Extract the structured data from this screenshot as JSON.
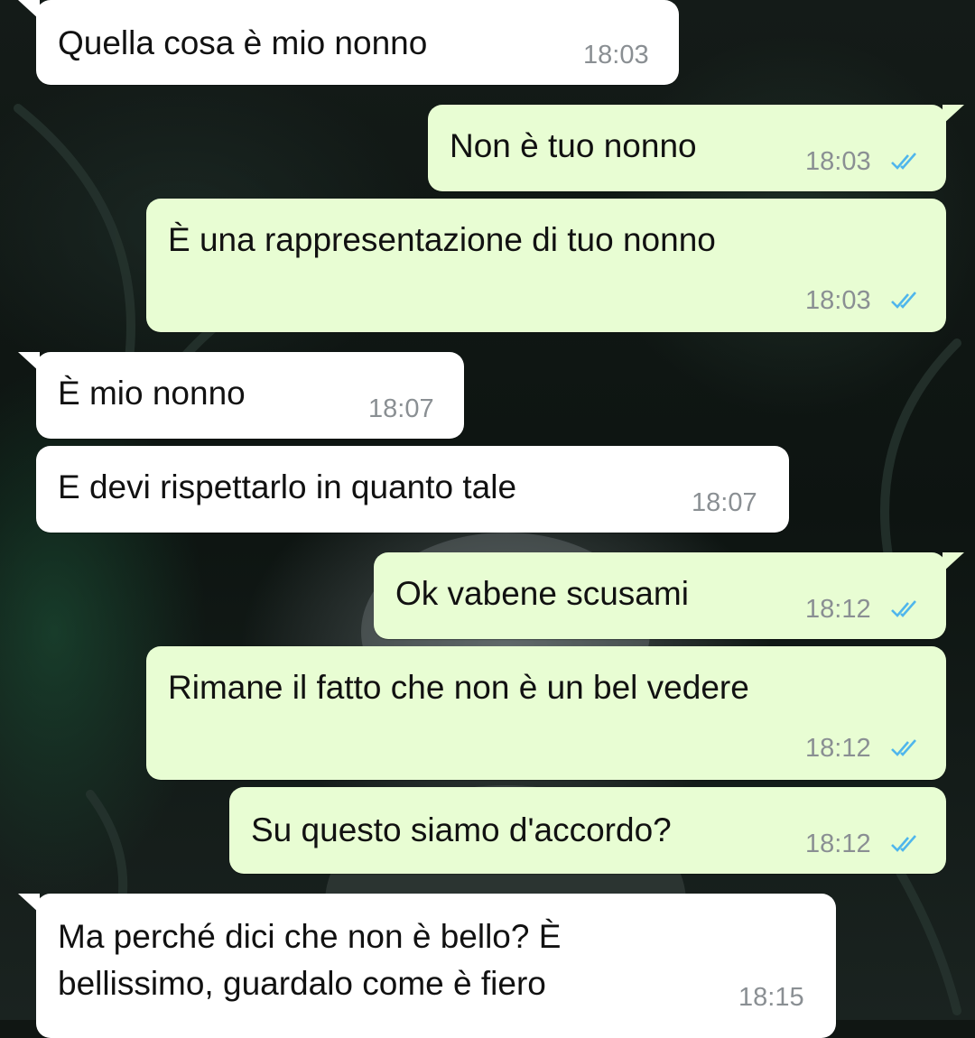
{
  "messages": [
    {
      "side": "in",
      "text": "Quella cosa è mio nonno",
      "time": "18:03"
    },
    {
      "side": "out",
      "text": "Non è tuo nonno",
      "time": "18:03",
      "status": "read"
    },
    {
      "side": "out",
      "text": "È una rappresentazione di tuo nonno",
      "time": "18:03",
      "status": "read"
    },
    {
      "side": "in",
      "text": "È mio nonno",
      "time": "18:07"
    },
    {
      "side": "in",
      "text": "E devi rispettarlo in quanto tale",
      "time": "18:07"
    },
    {
      "side": "out",
      "text": "Ok vabene scusami",
      "time": "18:12",
      "status": "read"
    },
    {
      "side": "out",
      "text": "Rimane il fatto che non è un bel vedere",
      "time": "18:12",
      "status": "read"
    },
    {
      "side": "out",
      "text": "Su questo siamo d'accordo?",
      "time": "18:12",
      "status": "read"
    },
    {
      "side": "in",
      "text": "Ma perché dici che non è bello? È bellissimo, guardalo come è fiero",
      "time": "18:15"
    }
  ],
  "colors": {
    "incoming_bubble": "#ffffff",
    "outgoing_bubble": "#e8fdd3",
    "read_ticks": "#4fb6ec",
    "timestamp": "#8a8f93"
  },
  "icons": {
    "read_receipt": "double-check-icon"
  }
}
